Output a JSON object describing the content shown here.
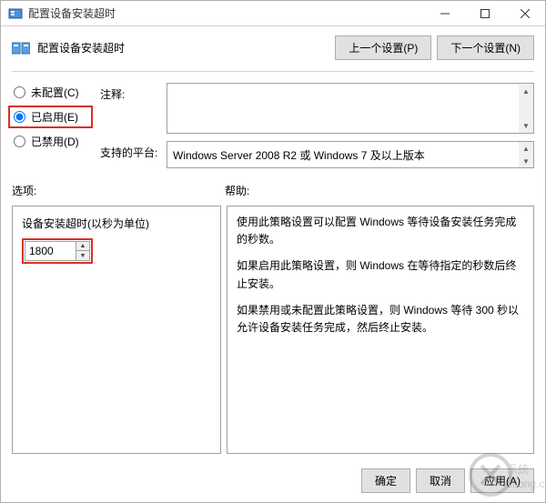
{
  "window": {
    "title": "配置设备安装超时"
  },
  "header": {
    "title": "配置设备安装超时",
    "prev_btn": "上一个设置(P)",
    "next_btn": "下一个设置(N)"
  },
  "radios": {
    "not_configured": "未配置(C)",
    "enabled": "已启用(E)",
    "disabled": "已禁用(D)",
    "selected": "enabled"
  },
  "fields": {
    "annotation_label": "注释:",
    "annotation_value": "",
    "platform_label": "支持的平台:",
    "platform_value": "Windows Server 2008 R2 或 Windows 7 及以上版本"
  },
  "sections": {
    "options_label": "选项:",
    "help_label": "帮助:"
  },
  "options": {
    "timeout_label": "设备安装超时(以秒为单位)",
    "timeout_value": "1800"
  },
  "help": {
    "p1": "使用此策略设置可以配置 Windows 等待设备安装任务完成的秒数。",
    "p2": "如果启用此策略设置，则 Windows 在等待指定的秒数后终止安装。",
    "p3": "如果禁用或未配置此策略设置，则 Windows 等待 300 秒以允许设备安装任务完成，然后终止安装。"
  },
  "footer": {
    "ok": "确定",
    "cancel": "取消",
    "apply": "应用(A)"
  }
}
